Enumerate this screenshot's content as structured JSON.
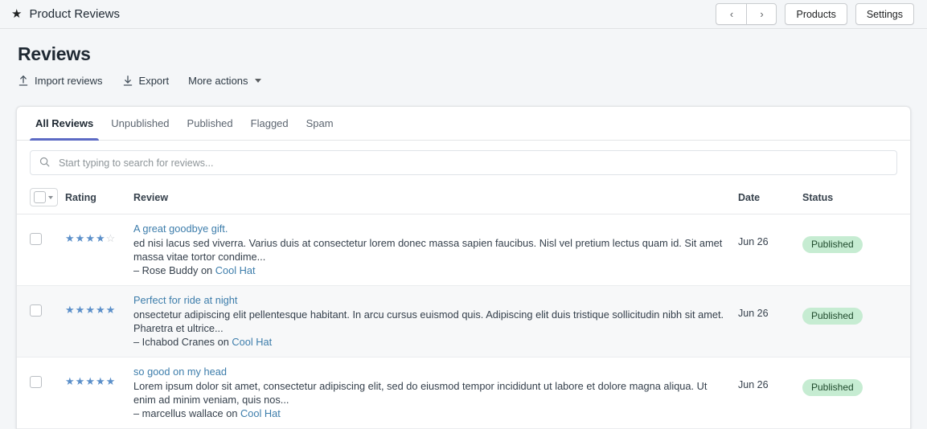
{
  "topbar": {
    "logo_icon": "star-icon",
    "app_title": "Product Reviews",
    "prev_label": "‹",
    "next_label": "›",
    "products_label": "Products",
    "settings_label": "Settings"
  },
  "page": {
    "title": "Reviews",
    "actions": [
      {
        "label": "Import reviews",
        "icon": "upload-icon"
      },
      {
        "label": "Export",
        "icon": "download-icon"
      },
      {
        "label": "More actions",
        "icon": "chevron-down-icon"
      }
    ]
  },
  "tabs": [
    {
      "label": "All Reviews",
      "active": true
    },
    {
      "label": "Unpublished",
      "active": false
    },
    {
      "label": "Published",
      "active": false
    },
    {
      "label": "Flagged",
      "active": false
    },
    {
      "label": "Spam",
      "active": false
    }
  ],
  "search": {
    "placeholder": "Start typing to search for reviews...",
    "value": "",
    "icon": "search-icon"
  },
  "table": {
    "headers": {
      "rating": "Rating",
      "review": "Review",
      "date": "Date",
      "status": "Status"
    },
    "rows": [
      {
        "rating": 4,
        "rating_max": 5,
        "title": "A great goodbye gift.",
        "body": "ed nisi lacus sed viverra. Varius duis at consectetur lorem donec massa sapien faucibus. Nisl vel pretium lectus quam id. Sit amet massa vitae tortor condime...",
        "author_prefix": "– Rose Buddy on ",
        "product": "Cool Hat",
        "date": "Jun 26",
        "status": "Published"
      },
      {
        "rating": 5,
        "rating_max": 5,
        "title": "Perfect for ride at night",
        "body": "onsectetur adipiscing elit pellentesque habitant. In arcu cursus euismod quis. Adipiscing elit duis tristique sollicitudin nibh sit amet. Pharetra et ultrice...",
        "author_prefix": "– Ichabod Cranes on ",
        "product": "Cool Hat",
        "date": "Jun 26",
        "status": "Published"
      },
      {
        "rating": 5,
        "rating_max": 5,
        "title": "so good on my head",
        "body": "Lorem ipsum dolor sit amet, consectetur adipiscing elit, sed do eiusmod tempor incididunt ut labore et dolore magna aliqua. Ut enim ad minim veniam, quis nos...",
        "author_prefix": "– marcellus wallace on ",
        "product": "Cool Hat",
        "date": "Jun 26",
        "status": "Published"
      }
    ]
  },
  "colors": {
    "accent": "#5c6ac4",
    "star": "#5b8fc9",
    "link": "#3d7dab",
    "badge_bg": "#c6ecd2",
    "badge_text": "#1f4a2c",
    "page_bg": "#f4f6f8"
  }
}
